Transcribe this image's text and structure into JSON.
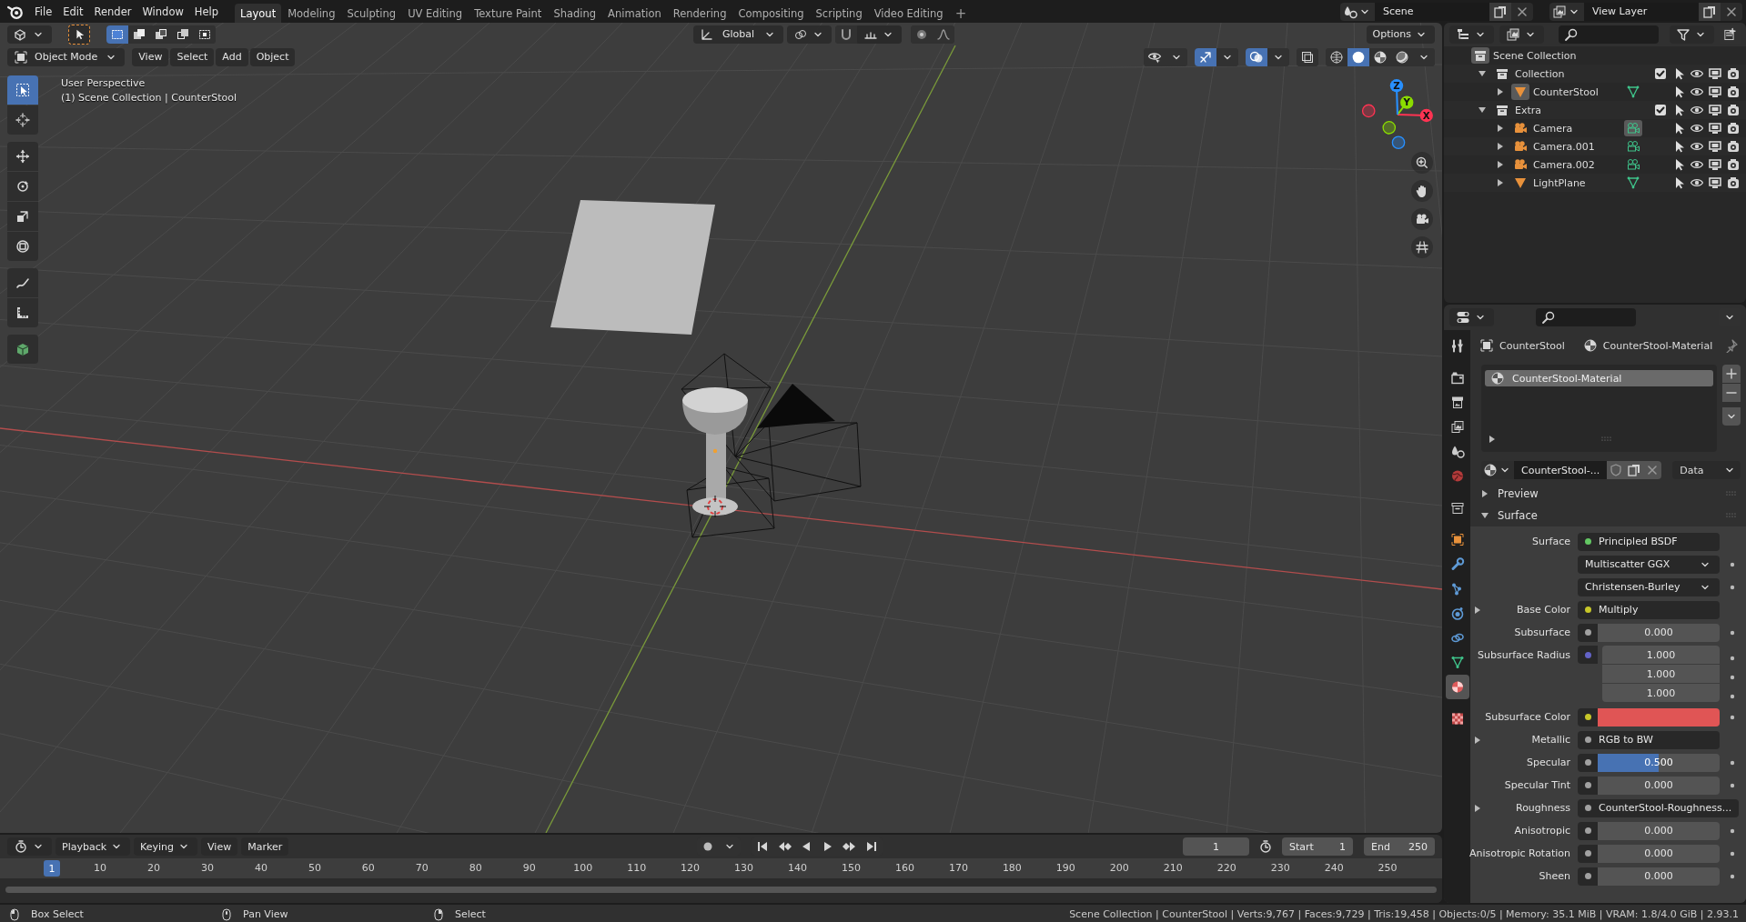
{
  "menu": [
    "File",
    "Edit",
    "Render",
    "Window",
    "Help"
  ],
  "workspaces": [
    {
      "label": "Layout",
      "selected": true
    },
    {
      "label": "Modeling",
      "selected": false
    },
    {
      "label": "Sculpting",
      "selected": false
    },
    {
      "label": "UV Editing",
      "selected": false
    },
    {
      "label": "Texture Paint",
      "selected": false
    },
    {
      "label": "Shading",
      "selected": false
    },
    {
      "label": "Animation",
      "selected": false
    },
    {
      "label": "Rendering",
      "selected": false
    },
    {
      "label": "Compositing",
      "selected": false
    },
    {
      "label": "Scripting",
      "selected": false
    },
    {
      "label": "Video Editing",
      "selected": false
    }
  ],
  "add_workspace": "+",
  "scene": "Scene",
  "view_layer": "View Layer",
  "viewport": {
    "select_modes": [
      {
        "kind": "set",
        "selected": true
      },
      {
        "kind": "extend",
        "selected": false
      },
      {
        "kind": "subtract",
        "selected": false
      },
      {
        "kind": "invert",
        "selected": false
      },
      {
        "kind": "intersect",
        "selected": false
      }
    ],
    "orientation": "Global",
    "options": "Options",
    "mode": "Object Mode",
    "menus": [
      "View",
      "Select",
      "Add",
      "Object"
    ],
    "toggles": [
      {
        "kind": "visibility",
        "on": false
      },
      {
        "kind": "gizmos",
        "on": true
      },
      {
        "kind": "overlays",
        "on": true
      },
      {
        "kind": "xray",
        "on": false
      }
    ],
    "shading": [
      {
        "kind": "wireframe",
        "selected": false
      },
      {
        "kind": "solid",
        "selected": true
      },
      {
        "kind": "material",
        "selected": false
      },
      {
        "kind": "rendered",
        "selected": false
      }
    ],
    "info": [
      "User Perspective",
      "(1) Scene Collection | CounterStool"
    ],
    "tools": [
      {
        "kind": "select",
        "selected": true
      },
      {
        "kind": "cursor",
        "selected": false
      },
      {
        "kind": "move",
        "selected": false
      },
      {
        "kind": "rotate",
        "selected": false
      },
      {
        "kind": "scale",
        "selected": false
      },
      {
        "kind": "transform",
        "selected": false
      },
      {
        "kind": "annotate",
        "selected": false
      },
      {
        "kind": "measure",
        "selected": false
      },
      {
        "kind": "add_cube",
        "selected": false
      }
    ],
    "axes": [
      {
        "label": "X",
        "color": "#ff3352"
      },
      {
        "label": "Y",
        "color": "#8bdc00"
      },
      {
        "label": "Z",
        "color": "#2890ff"
      }
    ],
    "nav": [
      {
        "kind": "zoom"
      },
      {
        "kind": "pan"
      },
      {
        "kind": "camera"
      },
      {
        "kind": "ortho"
      }
    ]
  },
  "outliner": {
    "root": {
      "name": "Scene Collection",
      "children": [
        {
          "name": "Collection",
          "kind": "collection",
          "expanded": true,
          "checked": true,
          "children": [
            {
              "name": "CounterStool",
              "kind": "mesh",
              "expanded": false,
              "active": true,
              "data_active": false
            }
          ]
        },
        {
          "name": "Extra",
          "kind": "collection",
          "expanded": true,
          "checked": true,
          "children": [
            {
              "name": "Camera",
              "kind": "camera",
              "expanded": false,
              "active": false,
              "data_active": true
            },
            {
              "name": "Camera.001",
              "kind": "camera",
              "expanded": false,
              "active": false,
              "data_active": false
            },
            {
              "name": "Camera.002",
              "kind": "camera",
              "expanded": false,
              "active": false,
              "data_active": false
            },
            {
              "name": "LightPlane",
              "kind": "mesh",
              "expanded": false,
              "active": false,
              "data_active": false
            }
          ]
        }
      ]
    }
  },
  "properties": {
    "tabs": [
      {
        "kind": "tool",
        "selected": false
      },
      {
        "kind": "render",
        "selected": false
      },
      {
        "kind": "output",
        "selected": false
      },
      {
        "kind": "view_layer",
        "selected": false
      },
      {
        "kind": "scene",
        "selected": false
      },
      {
        "kind": "world",
        "selected": false
      },
      {
        "kind": "collection",
        "selected": false
      },
      {
        "kind": "object",
        "selected": false
      },
      {
        "kind": "modifiers",
        "selected": false
      },
      {
        "kind": "particles",
        "selected": false
      },
      {
        "kind": "physics",
        "selected": false
      },
      {
        "kind": "constraints",
        "selected": false
      },
      {
        "kind": "data",
        "selected": false
      },
      {
        "kind": "material",
        "selected": true
      },
      {
        "kind": "texture",
        "selected": false
      }
    ],
    "context": {
      "object": "CounterStool",
      "material": "CounterStool-Material"
    },
    "slots": [
      {
        "name": "CounterStool-Material",
        "selected": true
      }
    ],
    "datablock": "CounterStool-...",
    "link": "Data",
    "panels": [
      {
        "title": "Preview",
        "expanded": false
      },
      {
        "title": "Surface",
        "expanded": true
      }
    ],
    "fields": [
      {
        "kind": "shader",
        "label": "Surface",
        "value": "Principled BSDF",
        "color": "#63c763"
      },
      {
        "kind": "dropdown",
        "value": "Multiscatter GGX"
      },
      {
        "kind": "dropdown",
        "value": "Christensen-Burley"
      },
      {
        "kind": "link",
        "label": "Base Color",
        "value": "Multiply",
        "color": "#c7c729"
      },
      {
        "kind": "number",
        "label": "Subsurface",
        "value": "0.000",
        "color": "#a1a1a1"
      },
      {
        "kind": "vector",
        "label": "Subsurface Radius",
        "values": [
          "1.000",
          "1.000",
          "1.000"
        ],
        "color": "#6363c7"
      },
      {
        "kind": "color",
        "label": "Subsurface Color",
        "swatch": {
          "color": "#e05555"
        },
        "color": "#c7c729"
      },
      {
        "kind": "link",
        "label": "Metallic",
        "value": "RGB to BW",
        "color": "#a1a1a1"
      },
      {
        "kind": "slider",
        "label": "Specular",
        "value": "0.500",
        "level": 0.5,
        "color": "#a1a1a1"
      },
      {
        "kind": "number",
        "label": "Specular Tint",
        "value": "0.000",
        "color": "#a1a1a1"
      },
      {
        "kind": "link",
        "label": "Roughness",
        "value": "CounterStool-Roughness...",
        "color": "#a1a1a1"
      },
      {
        "kind": "number",
        "label": "Anisotropic",
        "value": "0.000",
        "color": "#a1a1a1"
      },
      {
        "kind": "number",
        "label": "Anisotropic Rotation",
        "value": "0.000",
        "color": "#a1a1a1"
      },
      {
        "kind": "number",
        "label": "Sheen",
        "value": "0.000",
        "color": "#a1a1a1"
      }
    ]
  },
  "timeline": {
    "menus": [
      {
        "label": "Playback",
        "kind": "dropdown"
      },
      {
        "label": "Keying",
        "kind": "dropdown"
      },
      {
        "label": "View",
        "kind": "menu"
      },
      {
        "label": "Marker",
        "kind": "menu"
      }
    ],
    "auto_keying": false,
    "current_frame": "1",
    "start_label": "Start",
    "start": "1",
    "end_label": "End",
    "end": "250",
    "playhead": "1",
    "ruler": [
      "10",
      "20",
      "30",
      "40",
      "50",
      "60",
      "70",
      "80",
      "90",
      "100",
      "110",
      "120",
      "130",
      "140",
      "150",
      "160",
      "170",
      "180",
      "190",
      "200",
      "210",
      "220",
      "230",
      "240",
      "250"
    ]
  },
  "status": {
    "hints": [
      {
        "kind": "left",
        "label": "Box Select"
      },
      {
        "kind": "middle",
        "label": "Pan View"
      },
      {
        "kind": "right",
        "label": "Select"
      }
    ],
    "info": "Scene Collection | CounterStool | Verts:9,767 | Faces:9,729 | Tris:19,458 | Objects:0/5 | Memory: 35.1 MiB | VRAM: 1.8/4.0 GiB | 2.93.1"
  }
}
